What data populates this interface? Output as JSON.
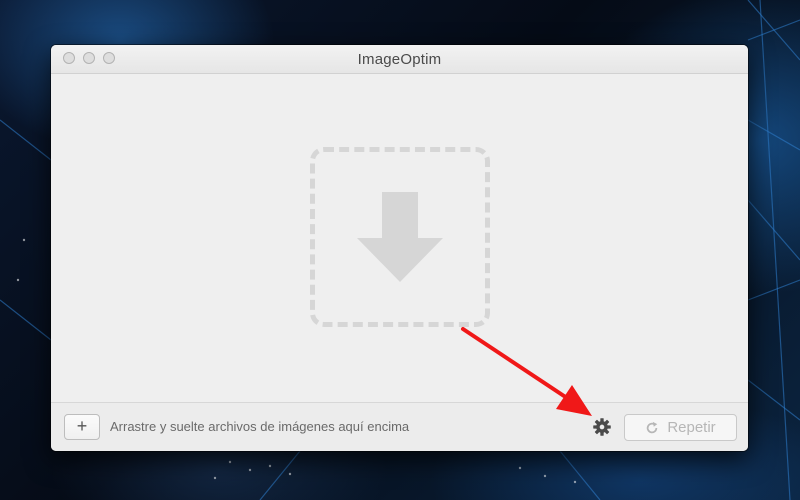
{
  "window": {
    "title": "ImageOptim"
  },
  "dropzone": {
    "icon": "download-arrow-icon"
  },
  "bottombar": {
    "add_label": "+",
    "hint": "Arrastre y suelte archivos de imágenes aquí encima",
    "settings_icon": "gear-icon",
    "repeat_label": "Repetir",
    "repeat_icon": "refresh-icon"
  },
  "annotation": {
    "arrow_color": "#f01818"
  },
  "colors": {
    "window_bg": "#ececec",
    "dropzone_border": "#d6d6d6",
    "disabled_text": "#b6b6b6"
  }
}
